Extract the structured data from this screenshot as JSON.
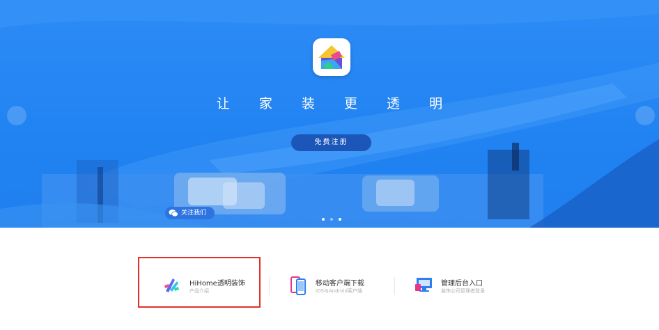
{
  "banner": {
    "tagline": "让 家 装 更 透 明",
    "register_label": "免费注册",
    "follow_label": "关注我们",
    "logo_icon": "house-logo-icon",
    "wechat_icon": "wechat-icon",
    "carousel": {
      "total": 3,
      "active": 3
    },
    "colors": {
      "primary": "#2183f2",
      "button": "#1b56b8"
    }
  },
  "features": [
    {
      "icon": "hihome-brush-icon",
      "title": "HiHome透明装饰",
      "subtitle": "产品介绍"
    },
    {
      "icon": "mobile-phones-icon",
      "title": "移动客户端下载",
      "subtitle": "iOS与Android客户端"
    },
    {
      "icon": "monitor-admin-icon",
      "title": "管理后台入口",
      "subtitle": "装饰公司管理者登录"
    }
  ],
  "highlight_color": "#e0322b"
}
